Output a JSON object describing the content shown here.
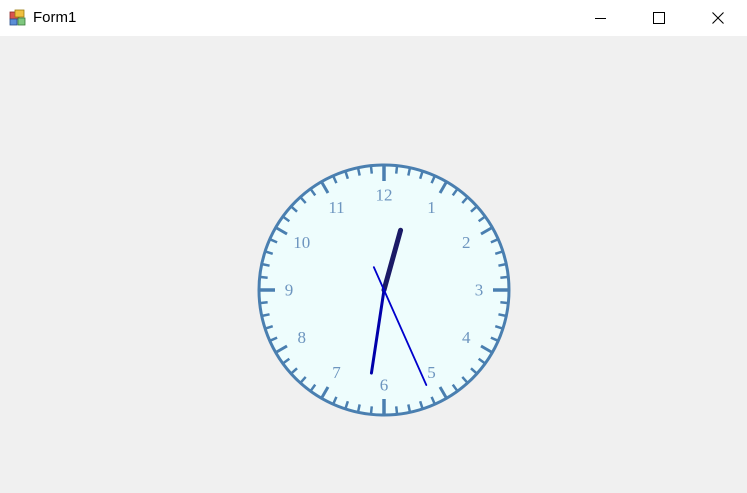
{
  "window": {
    "title": "Form1",
    "icon": "winforms-app-icon",
    "controls": {
      "minimize_icon": "minimize-icon",
      "maximize_icon": "maximize-icon",
      "close_icon": "close-icon"
    }
  },
  "clock": {
    "numerals": [
      "12",
      "1",
      "2",
      "3",
      "4",
      "5",
      "6",
      "7",
      "8",
      "9",
      "10",
      "11"
    ],
    "time": {
      "hour": 12,
      "minute": 31,
      "second": 26
    },
    "colors": {
      "face": "#eefdfd",
      "rim": "#4a7fb0",
      "ticks": "#4a7fb0",
      "numerals": "#6d95bf",
      "hour_hand": "#1a1a66",
      "minute_hand": "#0000aa",
      "second_hand": "#0000cc",
      "background": "#f0f0f0"
    }
  }
}
